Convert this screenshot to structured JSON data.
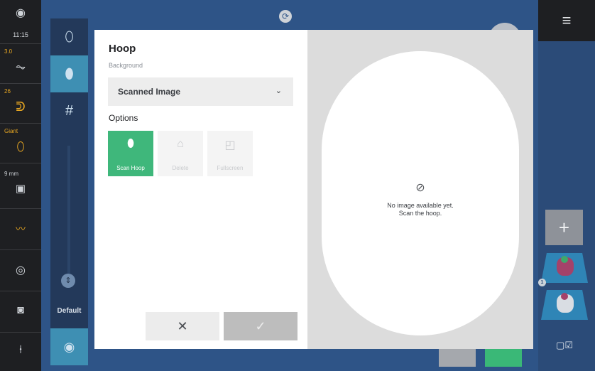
{
  "status_rail": {
    "time": "11:15",
    "stitch_width": "3.0",
    "stitch_length": "26",
    "presser_foot": "Giant",
    "buttonhole_size": "9 mm"
  },
  "tool_column": {
    "slider_label": "Default"
  },
  "dialog": {
    "title": "Hoop",
    "background_label": "Background",
    "background_value": "Scanned Image",
    "options_label": "Options",
    "options": [
      {
        "label": "Scan Hoop",
        "icon": "scan-hoop-icon",
        "enabled": true
      },
      {
        "label": "Delete",
        "icon": "trash-icon",
        "enabled": false
      },
      {
        "label": "Fullscreen",
        "icon": "fullscreen-icon",
        "enabled": false
      }
    ],
    "preview": {
      "message_line1": "No image available yet.",
      "message_line2": "Scan the hoop."
    }
  },
  "right_column": {
    "thumbnail_badge": "1"
  },
  "colors": {
    "accent_green": "#3fb77b",
    "rail_accent": "#e8a722",
    "canvas_blue": "#2e5487",
    "tool_active": "#3e8fb3"
  }
}
